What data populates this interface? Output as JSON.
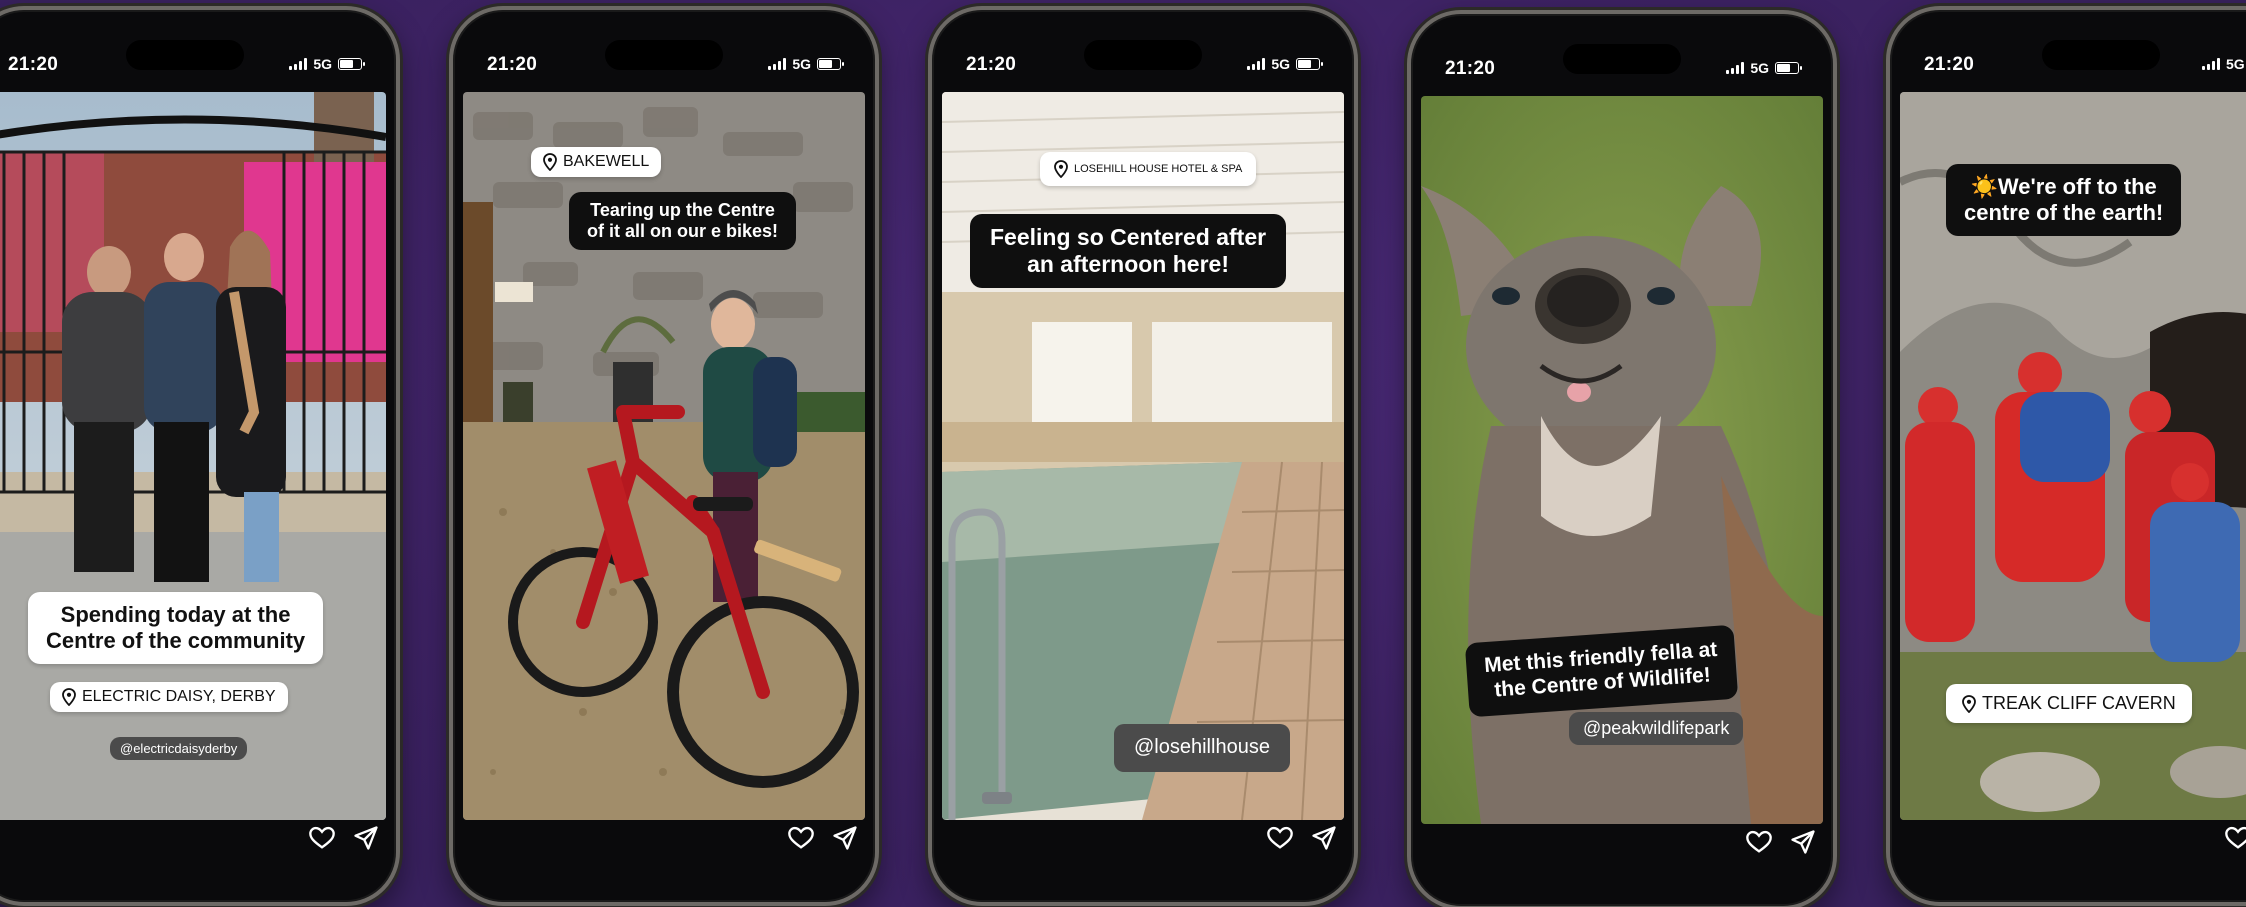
{
  "status": {
    "time": "21:20",
    "network": "5G"
  },
  "phones": [
    {
      "id": "derby",
      "location": "ELECTRIC DAISY, DERBY",
      "caption": "Spending today at the Centre of the community",
      "caption_l1": "Spending today at the",
      "caption_l2": "Centre of the community",
      "handle": "@electricdaisyderby"
    },
    {
      "id": "bakewell",
      "location": "BAKEWELL",
      "caption_l1": "Tearing up the Centre",
      "caption_l2": "of it all on our e bikes!"
    },
    {
      "id": "losehill",
      "location": "LOSEHILL HOUSE HOTEL & SPA",
      "caption_l1": "Feeling so Centered after",
      "caption_l2": "an afternoon here!",
      "handle": "@losehillhouse"
    },
    {
      "id": "wildlife",
      "caption_l1": "Met this friendly fella at",
      "caption_l2": "the Centre of Wildlife!",
      "handle": "@peakwildlifepark"
    },
    {
      "id": "cavern",
      "caption_l1": "We're off to the",
      "caption_l2": "centre of the earth!",
      "emoji": "☀️",
      "location": "TREAK CLIFF CAVERN"
    }
  ],
  "colors": {
    "background": "#3f2466",
    "sticker_black": "#0f0f0f",
    "sticker_white": "#ffffff",
    "handle_grey": "#4b4b4b"
  },
  "icons": [
    "signal-icon",
    "battery-icon",
    "location-pin-icon",
    "heart-icon",
    "send-icon",
    "sun-emoji-icon"
  ]
}
